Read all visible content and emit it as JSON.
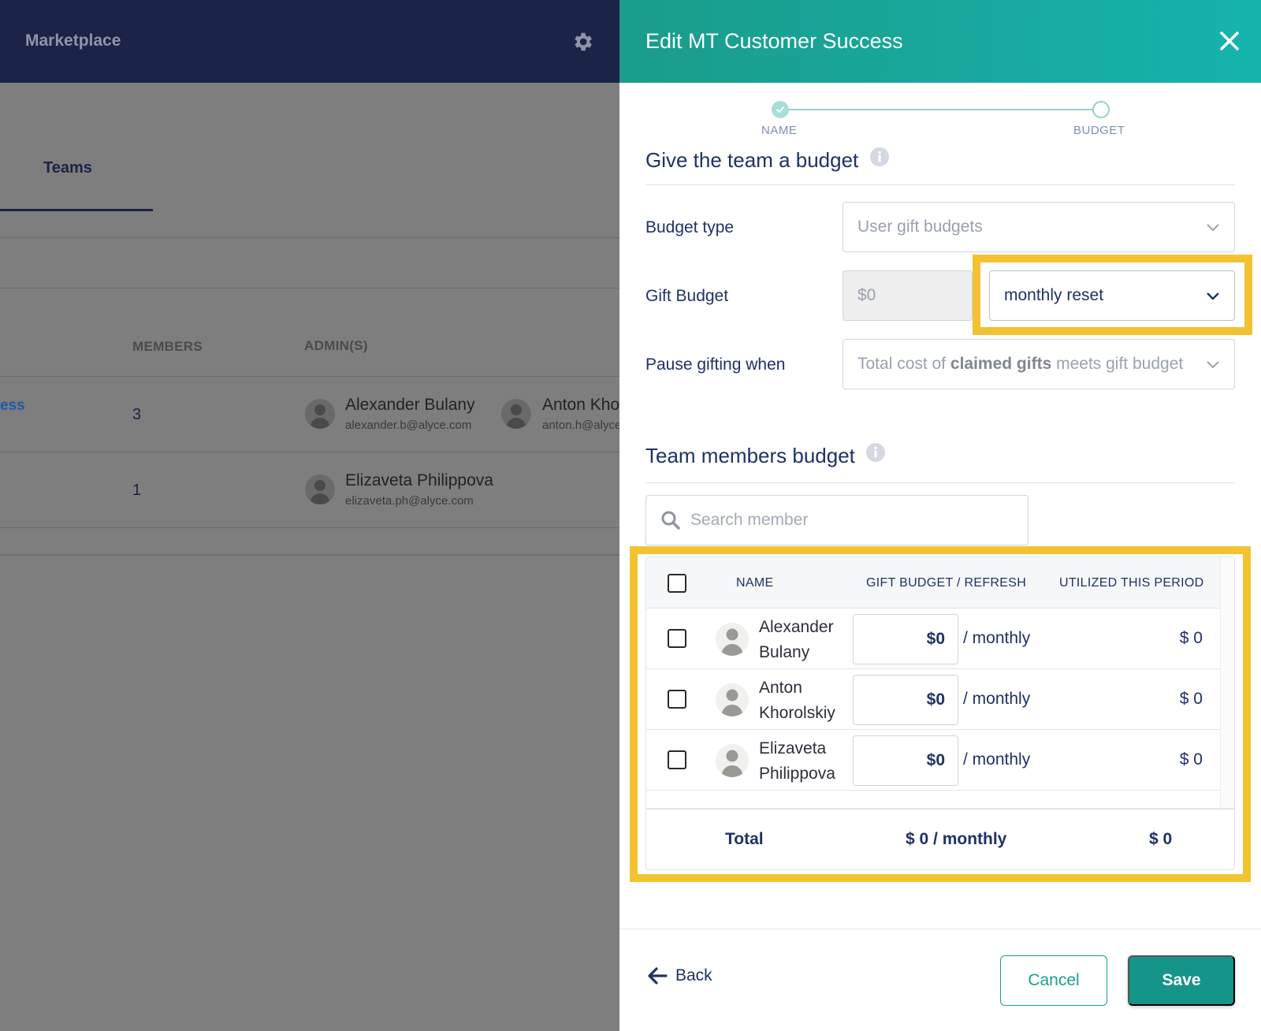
{
  "background": {
    "brand": "Marketplace",
    "active_tab": "Teams",
    "columns": {
      "members": "MEMBERS",
      "admins": "ADMIN(S)"
    },
    "rows": [
      {
        "team_link": "ess",
        "members": "3",
        "admins": [
          {
            "name": "Alexander Bulany",
            "email": "alexander.b@alyce.com"
          },
          {
            "name": "Anton Kho",
            "email": "anton.h@alyce"
          }
        ]
      },
      {
        "team_link": "",
        "members": "1",
        "admins": [
          {
            "name": "Elizaveta Philippova",
            "email": "elizaveta.ph@alyce.com"
          }
        ]
      }
    ]
  },
  "panel": {
    "title": "Edit MT Customer Success",
    "steps": [
      {
        "label": "NAME",
        "status": "done"
      },
      {
        "label": "BUDGET",
        "status": "current"
      }
    ],
    "budget_section": {
      "title": "Give the team a budget",
      "budget_type_label": "Budget type",
      "budget_type_value": "User gift budgets",
      "gift_budget_label": "Gift Budget",
      "gift_budget_value": "$0",
      "refresh_value": "monthly reset",
      "pause_label": "Pause gifting when",
      "pause_value_prefix": "Total cost of ",
      "pause_value_bold": "claimed gifts",
      "pause_value_suffix": " meets gift budget"
    },
    "members_section": {
      "title": "Team members budget",
      "search_placeholder": "Search member",
      "columns": {
        "name": "NAME",
        "budget": "GIFT BUDGET / REFRESH",
        "utilized": "UTILIZED THIS PERIOD"
      },
      "members": [
        {
          "name": "Alexander Bulany",
          "budget": "$0",
          "period": "/ monthly",
          "utilized": "$ 0"
        },
        {
          "name": "Anton Khorolskiy",
          "budget": "$0",
          "period": "/ monthly",
          "utilized": "$ 0"
        },
        {
          "name": "Elizaveta Philippova",
          "budget": "$0",
          "period": "/ monthly",
          "utilized": "$ 0"
        }
      ],
      "total": {
        "label": "Total",
        "budget": "$ 0 / monthly",
        "utilized": "$ 0"
      }
    },
    "footer": {
      "back": "Back",
      "cancel": "Cancel",
      "save": "Save"
    }
  },
  "colors": {
    "header_navy": "#1b2346",
    "teal": "#15958a",
    "highlight": "#f2c230"
  }
}
